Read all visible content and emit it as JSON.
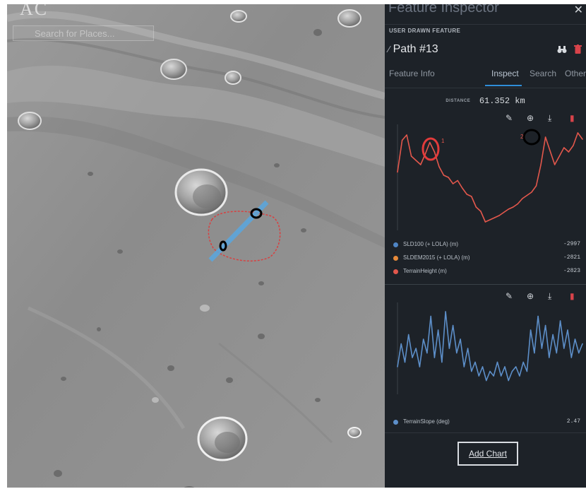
{
  "map": {
    "brand": "AC",
    "search_placeholder": "Search for Places..."
  },
  "panel": {
    "title": "Feature Inspector",
    "subtitle": "USER DRAWN FEATURE",
    "feature_name": "Path #13",
    "tabs": [
      {
        "label": "Feature Info",
        "active": false
      },
      {
        "label": "Inspect",
        "active": true
      },
      {
        "label": "Search",
        "active": false
      },
      {
        "label": "Other",
        "active": false
      }
    ],
    "distance_label": "DISTANCE",
    "distance_value": "61.352 km",
    "add_chart_label": "Add Chart"
  },
  "chart_data": [
    {
      "type": "line",
      "x": [
        0,
        0.025,
        0.05,
        0.075,
        0.1,
        0.125,
        0.15,
        0.175,
        0.2,
        0.225,
        0.25,
        0.275,
        0.3,
        0.325,
        0.35,
        0.375,
        0.4,
        0.425,
        0.45,
        0.475,
        0.5,
        0.525,
        0.55,
        0.575,
        0.6,
        0.625,
        0.65,
        0.675,
        0.7,
        0.725,
        0.75,
        0.775,
        0.8,
        0.825,
        0.85,
        0.875,
        0.9,
        0.925,
        0.95,
        0.975,
        1
      ],
      "series": [
        {
          "name": "SLDEM2015 (+ LOLA) (m)",
          "values": [
            0.55,
            0.85,
            0.9,
            0.7,
            0.66,
            0.62,
            0.72,
            0.83,
            0.74,
            0.6,
            0.52,
            0.5,
            0.44,
            0.47,
            0.4,
            0.34,
            0.32,
            0.22,
            0.18,
            0.08,
            0.1,
            0.12,
            0.14,
            0.17,
            0.2,
            0.22,
            0.25,
            0.3,
            0.33,
            0.36,
            0.42,
            0.62,
            0.88,
            0.75,
            0.62,
            0.7,
            0.78,
            0.74,
            0.8,
            0.92,
            0.86
          ],
          "color": "#e68a3a"
        },
        {
          "name": "TerrainHeight (m)",
          "values": [
            0.55,
            0.85,
            0.9,
            0.7,
            0.66,
            0.62,
            0.72,
            0.83,
            0.74,
            0.6,
            0.52,
            0.5,
            0.44,
            0.47,
            0.4,
            0.34,
            0.32,
            0.22,
            0.18,
            0.08,
            0.1,
            0.12,
            0.14,
            0.17,
            0.2,
            0.22,
            0.25,
            0.3,
            0.33,
            0.36,
            0.42,
            0.62,
            0.88,
            0.75,
            0.62,
            0.7,
            0.78,
            0.74,
            0.8,
            0.92,
            0.86
          ],
          "color": "#e2574c"
        }
      ],
      "legend": [
        {
          "name": "SLD100 (+ LOLA) (m)",
          "color": "#4f86c6",
          "value": "-2997"
        },
        {
          "name": "SLDEM2015 (+ LOLA) (m)",
          "color": "#e68a3a",
          "value": "-2821"
        },
        {
          "name": "TerrainHeight (m)",
          "color": "#e2574c",
          "value": "-2823"
        }
      ],
      "markers": [
        "1",
        "2"
      ]
    },
    {
      "type": "line",
      "x": [
        0,
        0.02,
        0.04,
        0.06,
        0.08,
        0.1,
        0.12,
        0.14,
        0.16,
        0.18,
        0.2,
        0.22,
        0.24,
        0.26,
        0.28,
        0.3,
        0.32,
        0.34,
        0.36,
        0.38,
        0.4,
        0.42,
        0.44,
        0.46,
        0.48,
        0.5,
        0.52,
        0.54,
        0.56,
        0.58,
        0.6,
        0.62,
        0.64,
        0.66,
        0.68,
        0.7,
        0.72,
        0.74,
        0.76,
        0.78,
        0.8,
        0.82,
        0.84,
        0.86,
        0.88,
        0.9,
        0.92,
        0.94,
        0.96,
        0.98,
        1
      ],
      "series": [
        {
          "name": "TerrainSlope (deg)",
          "values": [
            0.3,
            0.55,
            0.35,
            0.65,
            0.4,
            0.5,
            0.3,
            0.6,
            0.45,
            0.85,
            0.4,
            0.7,
            0.35,
            0.9,
            0.5,
            0.75,
            0.45,
            0.6,
            0.3,
            0.5,
            0.25,
            0.35,
            0.2,
            0.3,
            0.15,
            0.25,
            0.2,
            0.35,
            0.2,
            0.3,
            0.15,
            0.25,
            0.3,
            0.2,
            0.35,
            0.25,
            0.7,
            0.45,
            0.85,
            0.5,
            0.75,
            0.4,
            0.65,
            0.45,
            0.8,
            0.5,
            0.7,
            0.4,
            0.6,
            0.45,
            0.55
          ],
          "color": "#5d8fc9"
        }
      ],
      "legend": [
        {
          "name": "TerrainSlope (deg)",
          "color": "#5d8fc9",
          "value": "2.47"
        }
      ]
    }
  ]
}
